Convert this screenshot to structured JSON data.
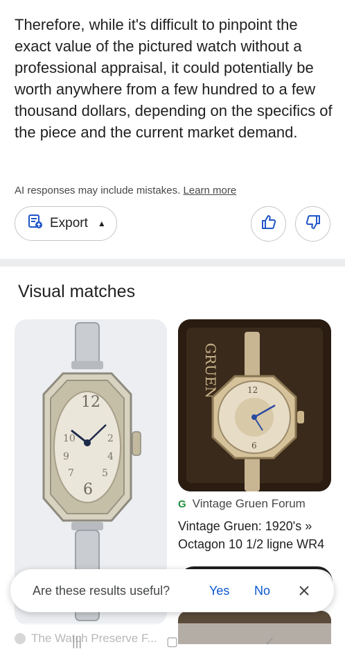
{
  "answer": {
    "text": "Therefore, while it's difficult to pinpoint the exact value of the pictured watch without a professional appraisal, it could potentially be worth anywhere from a few hundred to a few thousand dollars, depending on the specifics of the piece and the current market demand."
  },
  "disclaimer": {
    "text": "AI responses may include mistakes.",
    "link": "Learn more"
  },
  "actions": {
    "export_label": "Export",
    "export_icon": "export-doc-icon",
    "thumbs_up_icon": "thumbs-up-icon",
    "thumbs_down_icon": "thumbs-down-icon"
  },
  "visual_matches": {
    "title": "Visual matches",
    "results": [
      {
        "source": "The Watch Preserve F...",
        "title": ""
      },
      {
        "source": "Vintage Gruen Forum",
        "title": "Vintage Gruen: 1920's » Octagon 10 1/2 ligne WR4",
        "image_text": "GRUEN"
      }
    ]
  },
  "feedback_toast": {
    "question": "Are these results useful?",
    "yes": "Yes",
    "no": "No"
  },
  "colors": {
    "link_blue": "#0b57d0",
    "border": "#c4c7c5",
    "divider": "#ecedee"
  }
}
